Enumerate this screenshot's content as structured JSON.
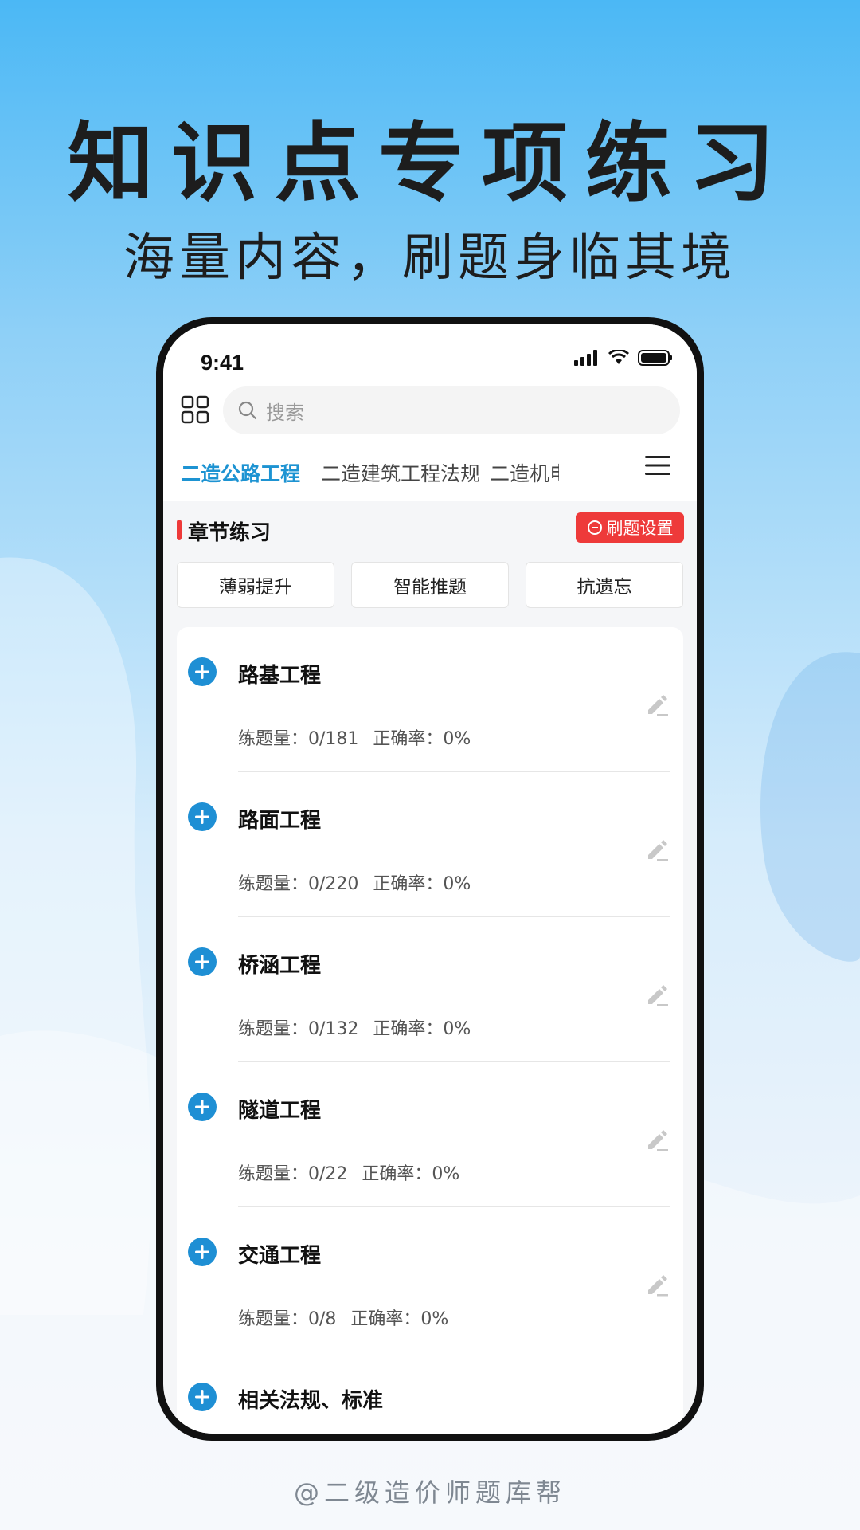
{
  "promo": {
    "headline": "知识点专项练习",
    "subheadline": "海量内容，刷题身临其境",
    "credit": "@二级造价师题库帮"
  },
  "status_bar": {
    "time": "9:41"
  },
  "search": {
    "placeholder": "搜索"
  },
  "tabs": [
    {
      "label": "二造公路工程",
      "active": true
    },
    {
      "label": "二造建筑工程法规",
      "active": false
    },
    {
      "label": "二造机电",
      "active": false
    }
  ],
  "section": {
    "title": "章节练习",
    "settings_label": "刷题设置"
  },
  "filters": [
    "薄弱提升",
    "智能推题",
    "抗遗忘"
  ],
  "chapters": [
    {
      "title": "路基工程",
      "count_label": "练题量：0/181",
      "rate_label": "正确率：0%"
    },
    {
      "title": "路面工程",
      "count_label": "练题量：0/220",
      "rate_label": "正确率：0%"
    },
    {
      "title": "桥涵工程",
      "count_label": "练题量：0/132",
      "rate_label": "正确率：0%"
    },
    {
      "title": "隧道工程",
      "count_label": "练题量：0/22",
      "rate_label": "正确率：0%"
    },
    {
      "title": "交通工程",
      "count_label": "练题量：0/8",
      "rate_label": "正确率：0%"
    },
    {
      "title": "相关法规、标准",
      "count_label": "",
      "rate_label": ""
    }
  ],
  "colors": {
    "accent": "#1d93d2",
    "danger": "#ee3a3a",
    "plus_icon": "#1e8fd4"
  },
  "icons": [
    "apps-grid-icon",
    "search-icon",
    "menu-icon",
    "plus-circle-icon",
    "edit-icon",
    "settings-icon",
    "signal-icon",
    "wifi-icon",
    "battery-icon"
  ]
}
